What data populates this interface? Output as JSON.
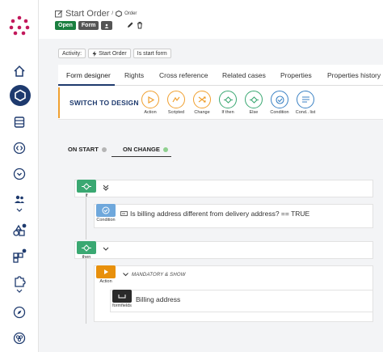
{
  "header": {
    "title": "Start Order",
    "separator": "/",
    "subtitle": "Order",
    "status_chips": [
      "Open",
      "Form"
    ]
  },
  "activity": {
    "label": "Activity:",
    "name": "Start Order",
    "flag": "Is start form"
  },
  "tabs": [
    "Form designer",
    "Rights",
    "Cross reference",
    "Related cases",
    "Properties",
    "Properties history"
  ],
  "toolbar": {
    "switch_label": "SWITCH TO DESIGN",
    "tools": [
      {
        "label": "Action",
        "icon": "play-icon",
        "color": "#f0a030"
      },
      {
        "label": "Scripted",
        "icon": "script-icon",
        "color": "#f0a030"
      },
      {
        "label": "Change",
        "icon": "shuffle-icon",
        "color": "#f0a030"
      },
      {
        "label": "If then",
        "icon": "diamond-icon",
        "color": "#3aa872"
      },
      {
        "label": "Else",
        "icon": "diamond-icon",
        "color": "#3aa872"
      },
      {
        "label": "Condition",
        "icon": "check-circle-icon",
        "color": "#3b82c4"
      },
      {
        "label": "Cond.. list",
        "icon": "list-icon",
        "color": "#3b82c4"
      }
    ]
  },
  "modes": {
    "on_start": "ON START",
    "on_change": "ON CHANGE"
  },
  "rules": {
    "if_label": "If",
    "condition_label": "Condition",
    "condition_text": "Is billing address different from delivery address? == TRUE",
    "then_label": "then",
    "action_label": "Action",
    "action_caption": "MANDATORY & SHOW",
    "formfields_label": "formfields",
    "field_text": "Billing address"
  },
  "colors": {
    "brand": "#1e3a6e",
    "green": "#3aa872",
    "orange": "#f0a030",
    "blue": "#3b82c4",
    "logo": "#c2185b"
  }
}
